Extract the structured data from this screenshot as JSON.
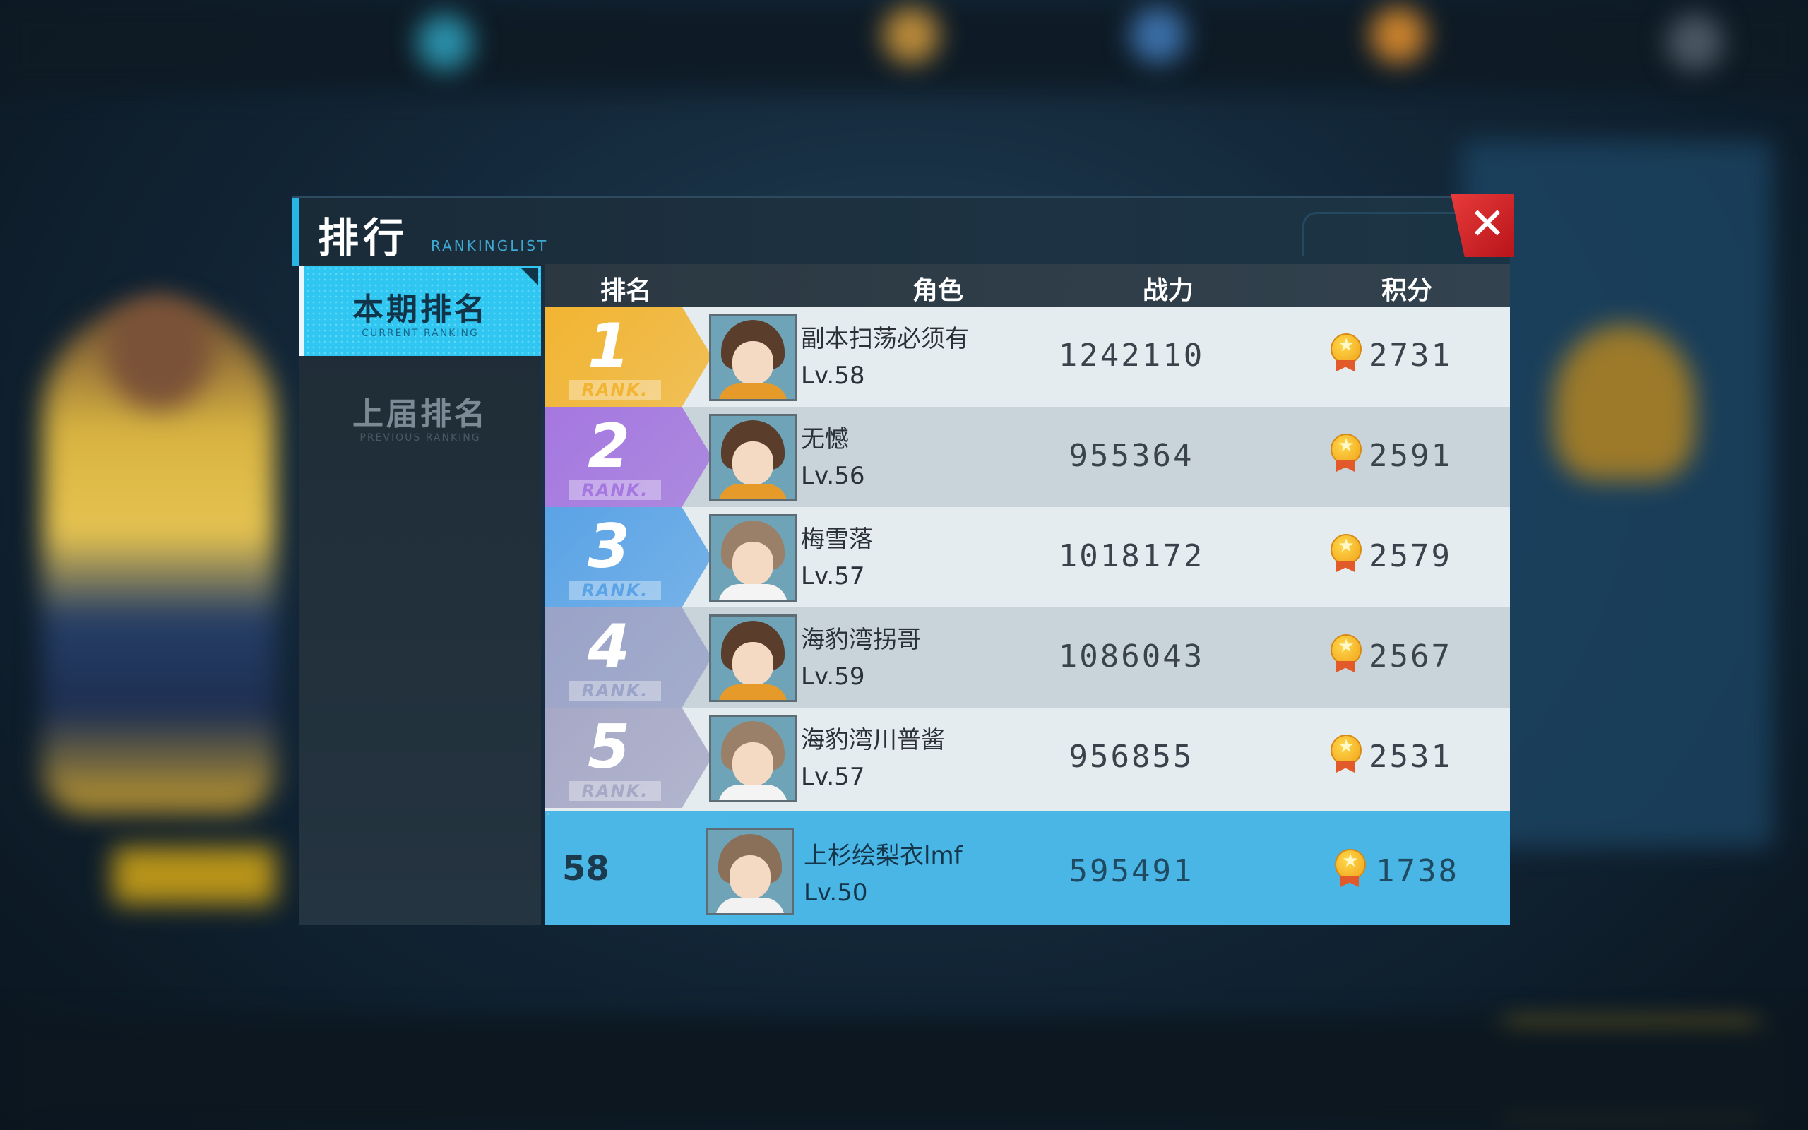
{
  "dialog": {
    "title": "排行",
    "title_sub": "RANKINGLIST",
    "close_label": "✕"
  },
  "tabs": [
    {
      "label": "本期排名",
      "sub": "CURRENT RANKING",
      "active": true
    },
    {
      "label": "上届排名",
      "sub": "PREVIOUS RANKING",
      "active": false
    }
  ],
  "table": {
    "headers": {
      "rank": "排名",
      "role": "角色",
      "power": "战力",
      "score": "积分"
    },
    "rank_label": "RANK.",
    "rows": [
      {
        "rank": "1",
        "name": "副本扫荡必须有",
        "level": "Lv.58",
        "power": "1242110",
        "score": "2731",
        "avatar": "boy"
      },
      {
        "rank": "2",
        "name": "无憾",
        "level": "Lv.56",
        "power": "955364",
        "score": "2591",
        "avatar": "boy"
      },
      {
        "rank": "3",
        "name": "梅雪落",
        "level": "Lv.57",
        "power": "1018172",
        "score": "2579",
        "avatar": "girl"
      },
      {
        "rank": "4",
        "name": "海豹湾拐哥",
        "level": "Lv.59",
        "power": "1086043",
        "score": "2567",
        "avatar": "boy"
      },
      {
        "rank": "5",
        "name": "海豹湾川普酱",
        "level": "Lv.57",
        "power": "956855",
        "score": "2531",
        "avatar": "girl"
      }
    ],
    "me": {
      "rank": "58",
      "name": "上杉绘梨衣lmf",
      "level": "Lv.50",
      "power": "595491",
      "score": "1738",
      "avatar": "girl"
    }
  },
  "colors": {
    "rank1": "#f2b431",
    "rank2": "#a577e0",
    "rank3": "#5aa3e6",
    "rank4": "#9aa3c8",
    "rank5": "#a6a8c6",
    "accent": "#2fc6f2",
    "close": "#d8252b"
  },
  "icons": {
    "medal": "gold-medal-icon",
    "close": "close-icon"
  }
}
